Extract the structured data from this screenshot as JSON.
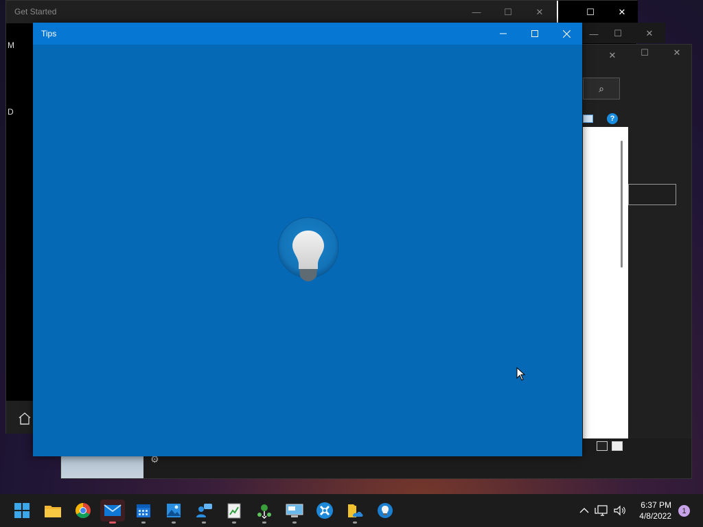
{
  "background_windows": {
    "get_started": {
      "title": "Get Started",
      "side_letters": [
        "M",
        "D"
      ]
    }
  },
  "tips_window": {
    "title": "Tips",
    "background_color": "#0569b5",
    "titlebar_color": "#0678d4",
    "center_icon": "lightbulb-icon"
  },
  "taskbar": {
    "apps": [
      {
        "name": "start-button",
        "icon": "windows-logo-icon"
      },
      {
        "name": "file-explorer",
        "icon": "folder-icon"
      },
      {
        "name": "chrome",
        "icon": "chrome-icon"
      },
      {
        "name": "mail",
        "icon": "mail-icon",
        "active": true
      },
      {
        "name": "calendar",
        "icon": "calendar-icon"
      },
      {
        "name": "photos",
        "icon": "photos-icon"
      },
      {
        "name": "people",
        "icon": "people-icon"
      },
      {
        "name": "notepad-chart",
        "icon": "chart-document-icon"
      },
      {
        "name": "network-tool",
        "icon": "network-icon"
      },
      {
        "name": "remote-desktop",
        "icon": "remote-desktop-icon"
      },
      {
        "name": "settings-tool",
        "icon": "tool-icon"
      },
      {
        "name": "onedrive-folder",
        "icon": "cloud-folder-icon"
      },
      {
        "name": "tips",
        "icon": "lightbulb-icon"
      }
    ],
    "tray": {
      "time": "6:37 PM",
      "date": "4/8/2022",
      "notification_count": "1"
    }
  }
}
